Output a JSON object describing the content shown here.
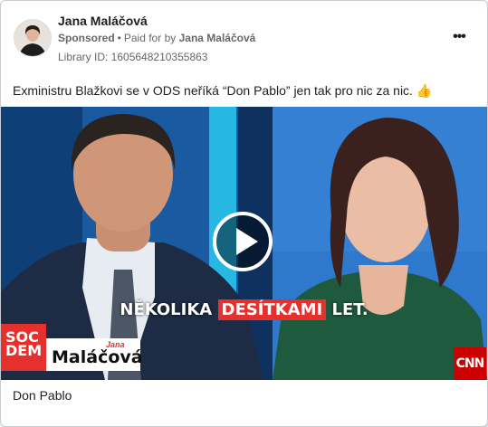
{
  "header": {
    "name": "Jana Maláčová",
    "sponsored_label": "Sponsored",
    "separator": "•",
    "paid_for_label": "Paid for by",
    "payer": "Jana Maláčová",
    "library_id": "Library ID: 1605648210355863",
    "more_icon": "more-horizontal-icon",
    "more_label": "•••"
  },
  "post": {
    "text": "Exministru Blažkovi se v ODS neříká “Don Pablo” jen tak pro nic za nic. 👍"
  },
  "video": {
    "caption_before": "NĚKOLIKA",
    "caption_highlight": "DESÍTKAMI",
    "caption_after": "LET.",
    "logo_line1": "SOC",
    "logo_line2": "DEM",
    "logo_first_name": "Jana",
    "logo_last_name": "Maláčová",
    "channel": "CNN",
    "play_icon": "play-icon",
    "accent_red": "#e5312d"
  },
  "footer": {
    "title": "Don Pablo"
  }
}
